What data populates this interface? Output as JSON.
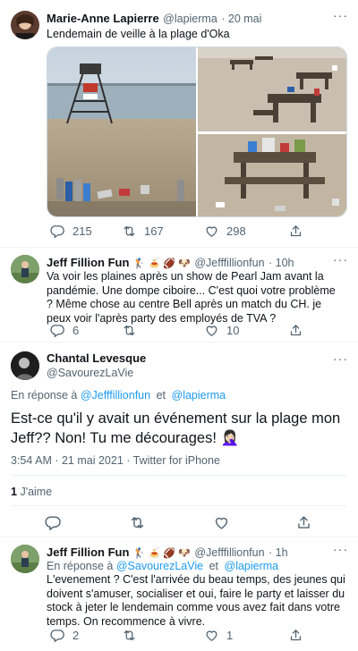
{
  "tweet1": {
    "name": "Marie-Anne Lapierre",
    "handle": "@lapierma",
    "date": "· 20 mai",
    "text": "Lendemain de veille à la plage d'Oka",
    "replies": "215",
    "retweets": "167",
    "likes": "298"
  },
  "reply1": {
    "name": "Jeff Fillion Fun",
    "emojis": "🏌 🍝 🏈 🐶",
    "handle": "@Jefffillionfun",
    "date": "· 10h",
    "text": "Va voir les plaines après un show de Pearl Jam avant la pandémie. Une dompe ciboire... C'est quoi votre problème ? Même chose au centre Bell après un match du CH. je peux voir l'après party des employés de TVA ?",
    "replies": "6",
    "retweets": "",
    "likes": "10"
  },
  "main": {
    "name": "Chantal Levesque",
    "handle": "@SavourezLaVie",
    "reply_prefix": "En réponse à",
    "reply_to_1": "@Jefffillionfun",
    "reply_and": "et",
    "reply_to_2": "@lapierma",
    "text": "Est-ce qu'il y avait un événement sur la plage mon Jeff?? Non! Tu me décourages! 🤦🏻‍♀️",
    "timestamp": "3:54 AM · 21 mai 2021 · Twitter for iPhone",
    "likes_count": "1",
    "likes_label": "J'aime"
  },
  "reply2": {
    "name": "Jeff Fillion Fun",
    "emojis": "🏌 🍝 🏈 🐶",
    "handle": "@Jefffillionfun",
    "date": "· 1h",
    "reply_prefix": "En réponse à",
    "reply_to_1": "@SavourezLaVie",
    "reply_and": "et",
    "reply_to_2": "@lapierma",
    "text": "L'evenement ? C'est l'arrivée du beau temps, des jeunes qui doivent s'amuser, socialiser et oui, faire le party et laisser du stock à jeter le lendemain comme vous avez fait dans votre temps. On recommence à vivre.",
    "replies": "2",
    "retweets": "",
    "likes": "1"
  },
  "colors": {
    "accent": "#1d9bf0",
    "muted": "#536471",
    "text": "#0f1419",
    "divider": "#eff3f4"
  },
  "icons": [
    "reply-icon",
    "retweet-icon",
    "like-icon",
    "share-icon",
    "more-icon"
  ]
}
